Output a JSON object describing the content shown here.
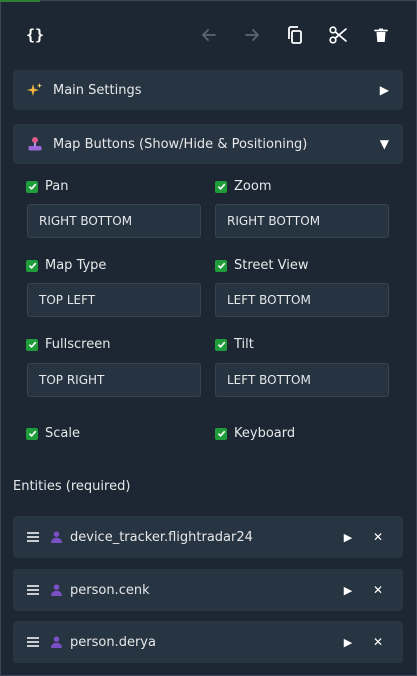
{
  "toolbar": {
    "code_label": "{}",
    "icons": [
      "undo-icon",
      "redo-icon",
      "copy-icon",
      "cut-icon",
      "delete-icon"
    ]
  },
  "main_settings": {
    "title": "Main Settings",
    "toggle": "▶"
  },
  "map_buttons": {
    "title": "Map Buttons (Show/Hide & Positioning)",
    "toggle": "▼",
    "options": {
      "pan": {
        "label": "Pan",
        "checked": true,
        "position": "RIGHT BOTTOM"
      },
      "zoom": {
        "label": "Zoom",
        "checked": true,
        "position": "RIGHT BOTTOM"
      },
      "map_type": {
        "label": "Map Type",
        "checked": true,
        "position": "TOP LEFT"
      },
      "street_view": {
        "label": "Street View",
        "checked": true,
        "position": "LEFT BOTTOM"
      },
      "fullscreen": {
        "label": "Fullscreen",
        "checked": true,
        "position": "TOP RIGHT"
      },
      "tilt": {
        "label": "Tilt",
        "checked": true,
        "position": "LEFT BOTTOM"
      },
      "scale": {
        "label": "Scale",
        "checked": true
      },
      "keyboard": {
        "label": "Keyboard",
        "checked": true
      }
    }
  },
  "entities": {
    "label": "Entities (required)",
    "items": [
      {
        "name": "device_tracker.flightradar24",
        "expand": "▶",
        "remove": "✕"
      },
      {
        "name": "person.cenk",
        "expand": "▶",
        "remove": "✕"
      },
      {
        "name": "person.derya",
        "expand": "▶",
        "remove": "✕"
      }
    ]
  },
  "colors": {
    "background": "#1c2733",
    "card": "#273441",
    "checkbox": "#1f9d3a",
    "text": "#e6e8ea",
    "person_icon": "#7b4fc4"
  }
}
